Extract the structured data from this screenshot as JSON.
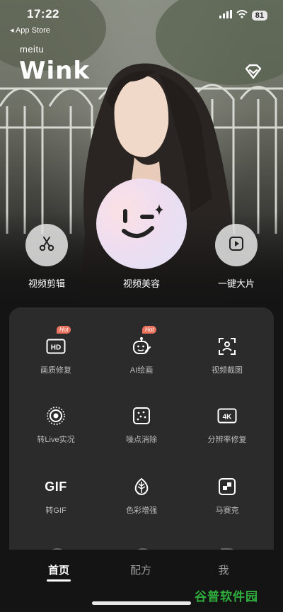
{
  "status": {
    "time": "17:22",
    "back_label": "◂ App Store",
    "battery": "81"
  },
  "brand": {
    "small": "meitu",
    "name": "Wink"
  },
  "actions": [
    {
      "label": "视频剪辑",
      "icon": "scissors-icon"
    },
    {
      "label": "视频美容",
      "icon": "wink-face-icon"
    },
    {
      "label": "一键大片",
      "icon": "play-icon"
    }
  ],
  "tools": [
    {
      "label": "画质修复",
      "icon": "hd-icon",
      "badge": "Hot"
    },
    {
      "label": "AI绘画",
      "icon": "ai-painting-icon",
      "badge": "Hot"
    },
    {
      "label": "视频截图",
      "icon": "video-screenshot-icon"
    },
    {
      "label": "转Live实况",
      "icon": "live-photo-icon"
    },
    {
      "label": "噪点消除",
      "icon": "denoise-icon"
    },
    {
      "label": "分辨率修复",
      "icon": "resolution-4k-icon",
      "icon_text": "4K"
    },
    {
      "label": "转GIF",
      "icon": "gif-icon",
      "icon_text": "GIF"
    },
    {
      "label": "色彩增强",
      "icon": "color-enhance-icon"
    },
    {
      "label": "马赛克",
      "icon": "mosaic-icon"
    }
  ],
  "tabs": {
    "home": "首页",
    "recipe": "配方",
    "me": "我"
  },
  "watermark": "谷普软件园",
  "colors": {
    "accent_badge": "#e9735f",
    "panel_bg": "#2b2b2c",
    "watermark": "#2fae3d"
  }
}
